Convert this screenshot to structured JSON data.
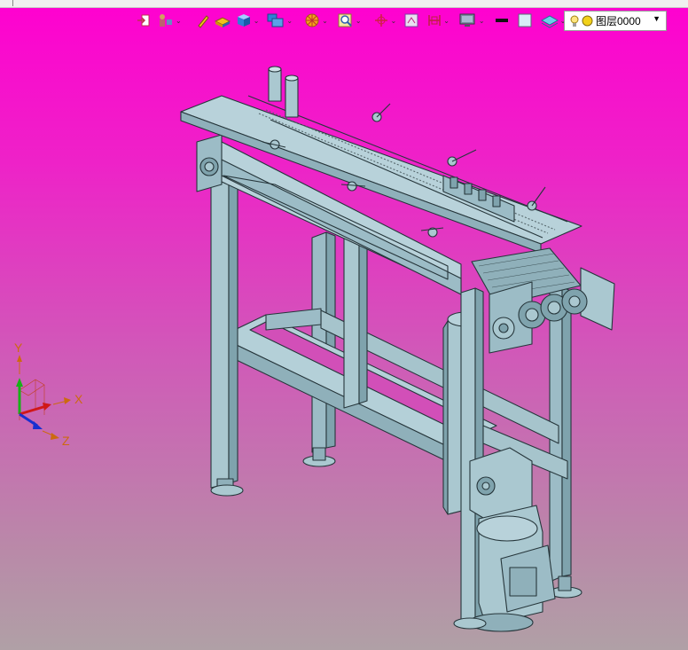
{
  "toolbar": {
    "icons": [
      "snap-icon",
      "measure-icon",
      "pen-icon",
      "render-icon",
      "cube-icon",
      "view-icon",
      "sphere-icon",
      "zoom-icon",
      "axis-icon",
      "frame-icon",
      "dimension-icon",
      "monitor-icon",
      "line-color-icon",
      "fill-color-icon",
      "layer-icon"
    ],
    "colors": {
      "toolbar_bg": "#f0f0f0",
      "accent_blue": "#2f7fd6",
      "accent_yellow": "#f2c21a"
    }
  },
  "layer": {
    "name": "图层0000"
  },
  "triad": {
    "x_label": "X",
    "y_label": "Y",
    "z_label": "Z"
  },
  "model": {
    "description_hidden": true,
    "colors": {
      "steel": "#aac8d0",
      "steel_dark": "#7fa3ad",
      "edge": "#2a3b40",
      "background_top": "#ff00d0",
      "background_bottom": "#b0a0a6"
    }
  }
}
